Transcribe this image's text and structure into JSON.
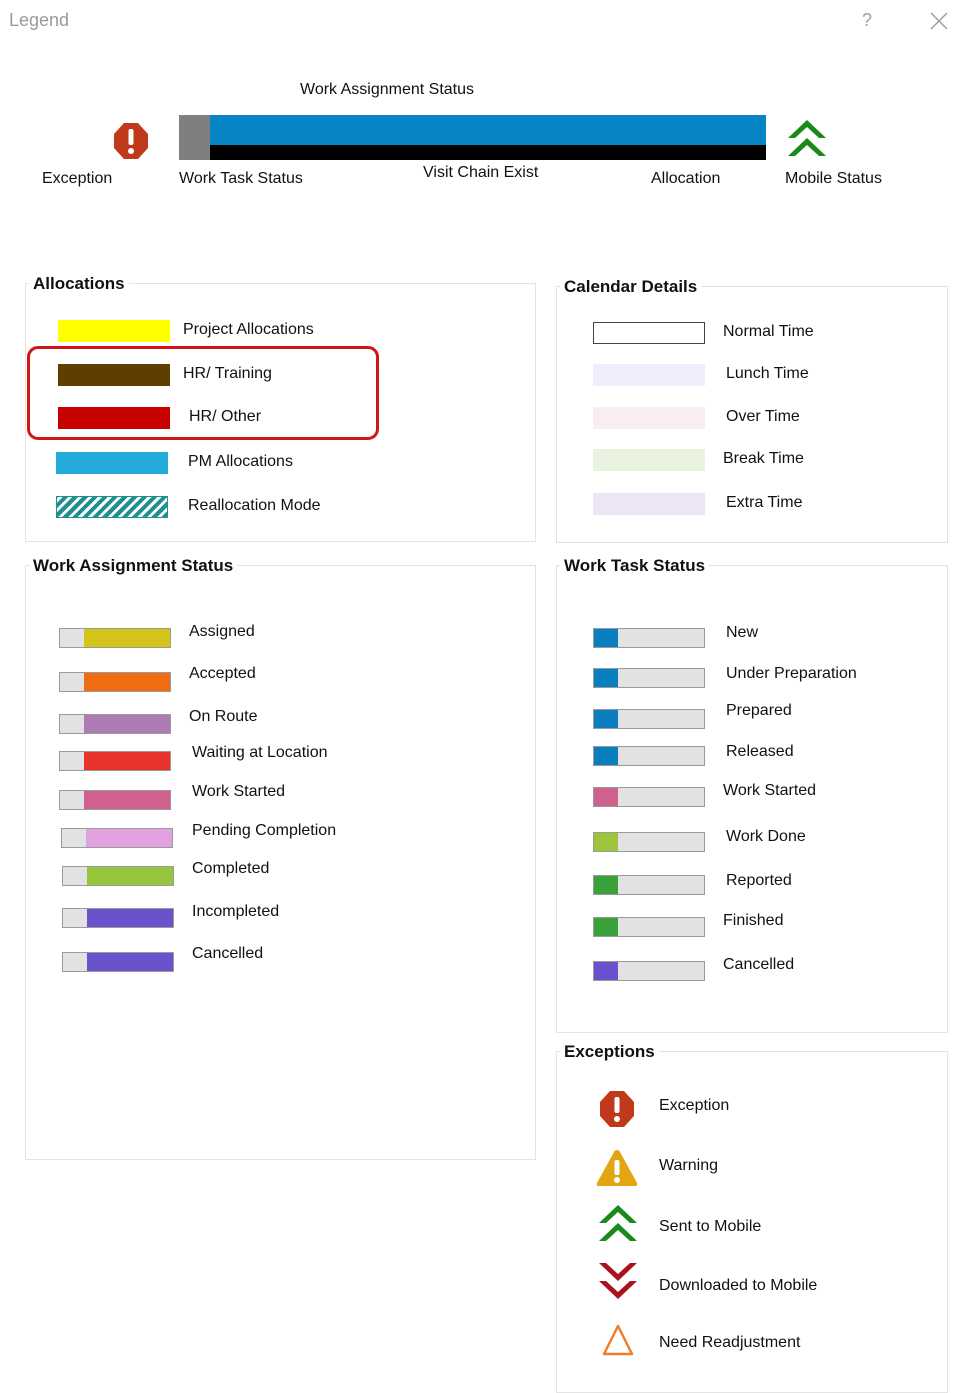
{
  "window": {
    "title": "Legend",
    "help_glyph": "?"
  },
  "overview": {
    "heading": "Work Assignment Status",
    "exception": "Exception",
    "work_task_status": "Work Task Status",
    "visit_chain": "Visit Chain Exist",
    "allocation": "Allocation",
    "mobile_status": "Mobile Status"
  },
  "allocations": {
    "title": "Allocations",
    "items": [
      {
        "label": "Project Allocations",
        "color": "#ffff00"
      },
      {
        "label": "HR/ Training",
        "color": "#5e3f00"
      },
      {
        "label": "HR/ Other",
        "color": "#c80000"
      },
      {
        "label": "PM Allocations",
        "color": "#22aad8"
      },
      {
        "label": "Reallocation Mode",
        "color": "#1f8f8f"
      }
    ]
  },
  "calendar": {
    "title": "Calendar Details",
    "items": [
      {
        "label": "Normal Time",
        "color": "#ffffff"
      },
      {
        "label": "Lunch Time",
        "color": "#eeeefc"
      },
      {
        "label": "Over Time",
        "color": "#f8eef0"
      },
      {
        "label": "Break Time",
        "color": "#e8f2de"
      },
      {
        "label": "Extra Time",
        "color": "#ece6f4"
      }
    ]
  },
  "work_assignment_status": {
    "title": "Work Assignment Status",
    "items": [
      {
        "label": "Assigned",
        "color": "#d4c41a"
      },
      {
        "label": "Accepted",
        "color": "#ee6c12"
      },
      {
        "label": "On Route",
        "color": "#ad7ab4"
      },
      {
        "label": "Waiting at Location",
        "color": "#e8322c"
      },
      {
        "label": "Work Started",
        "color": "#d0608e"
      },
      {
        "label": "Pending Completion",
        "color": "#e2a2e0"
      },
      {
        "label": "Completed",
        "color": "#96c43a"
      },
      {
        "label": "Incompleted",
        "color": "#6a52cc"
      },
      {
        "label": "Cancelled",
        "color": "#6a52cc"
      }
    ]
  },
  "work_task_status": {
    "title": "Work Task Status",
    "items": [
      {
        "label": "New",
        "color": "#0a7fc0"
      },
      {
        "label": "Under Preparation",
        "color": "#0a7fc0"
      },
      {
        "label": "Prepared",
        "color": "#0a7fc0"
      },
      {
        "label": "Released",
        "color": "#0a7fc0"
      },
      {
        "label": "Work Started",
        "color": "#d0608e"
      },
      {
        "label": "Work Done",
        "color": "#9cc43c"
      },
      {
        "label": "Reported",
        "color": "#3aa23a"
      },
      {
        "label": "Finished",
        "color": "#3aa23a"
      },
      {
        "label": "Cancelled",
        "color": "#6a52cc"
      }
    ]
  },
  "exceptions": {
    "title": "Exceptions",
    "items": [
      {
        "label": "Exception",
        "icon": "exception-icon"
      },
      {
        "label": "Warning",
        "icon": "warning-icon"
      },
      {
        "label": "Sent to Mobile",
        "icon": "sent-to-mobile-icon"
      },
      {
        "label": "Downloaded to Mobile",
        "icon": "downloaded-to-mobile-icon"
      },
      {
        "label": "Need Readjustment",
        "icon": "need-readjustment-icon"
      }
    ]
  }
}
